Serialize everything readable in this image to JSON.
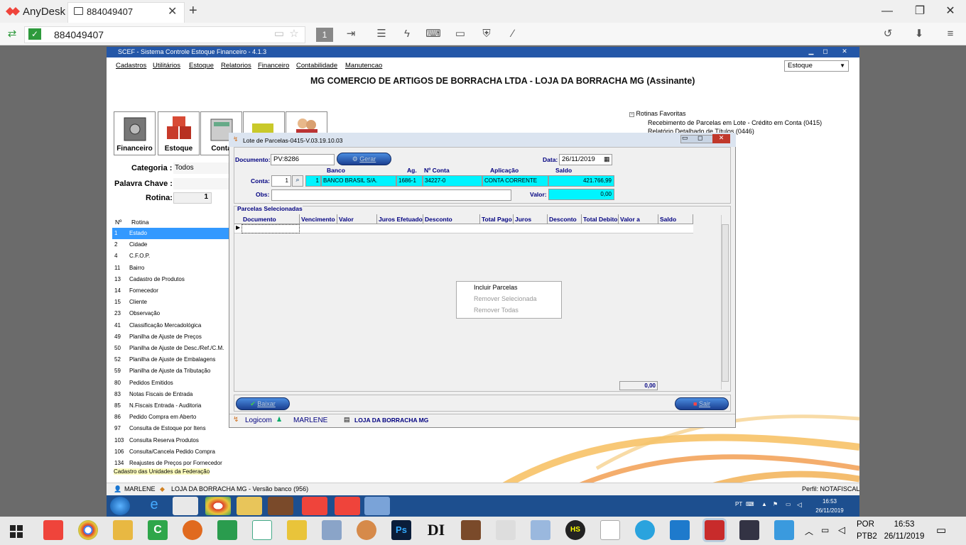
{
  "anydesk": {
    "brand": "AnyDesk",
    "tab_label": "884049407",
    "address": "884049407",
    "toolbar_page": "1",
    "colors": {
      "accent": "#ef443b"
    }
  },
  "scef": {
    "window_title": "SCEF - Sistema Controle Estoque Financeiro - 4.1.3",
    "menu": [
      "Cadastros",
      "Utilitários",
      "Estoque",
      "Relatorios",
      "Financeiro",
      "Contabilidade",
      "Manutencao"
    ],
    "module_select": "Estoque",
    "company_title": "MG COMERCIO DE ARTIGOS DE BORRACHA LTDA - LOJA DA BORRACHA MG (Assinante)",
    "modules": [
      "Financeiro",
      "Estoque",
      "Conta"
    ],
    "categoria_label": "Categoria :",
    "categoria_value": "Todos",
    "palavra_chave_label": "Palavra Chave :",
    "rotina_label": "Rotina:",
    "rotina_value": "1",
    "rotinas_header": {
      "num": "Nº",
      "name": "Rotina"
    },
    "rotinas": [
      {
        "num": "1",
        "name": "Estado"
      },
      {
        "num": "2",
        "name": "Cidade"
      },
      {
        "num": "4",
        "name": "C.F.O.P."
      },
      {
        "num": "11",
        "name": "Bairro"
      },
      {
        "num": "13",
        "name": "Cadastro de Produtos"
      },
      {
        "num": "14",
        "name": "Fornecedor"
      },
      {
        "num": "15",
        "name": "Cliente"
      },
      {
        "num": "23",
        "name": "Observação"
      },
      {
        "num": "41",
        "name": "Classificação Mercadológica"
      },
      {
        "num": "49",
        "name": "Planilha de Ajuste de Preços"
      },
      {
        "num": "50",
        "name": "Planilha de Ajuste de Desc./Ref./C.M."
      },
      {
        "num": "52",
        "name": "Planilha de Ajuste de Embalagens"
      },
      {
        "num": "59",
        "name": "Planilha de Ajuste da Tributação"
      },
      {
        "num": "80",
        "name": "Pedidos Emitidos"
      },
      {
        "num": "83",
        "name": "Notas Fiscais de Entrada"
      },
      {
        "num": "85",
        "name": "N.Fiscais Entrada - Auditoria"
      },
      {
        "num": "86",
        "name": "Pedido Compra em Aberto"
      },
      {
        "num": "97",
        "name": "Consulta de Estoque por Itens"
      },
      {
        "num": "103",
        "name": "Consulta Reserva Produtos"
      },
      {
        "num": "106",
        "name": "Consulta/Cancela Pedido Compra"
      },
      {
        "num": "134",
        "name": "Reajustes de Preços por Fornecedor"
      }
    ],
    "rotina_hint": "Cadastro das Unidades da Federação",
    "favorites_title": "Rotinas Favoritas",
    "favorites": [
      "Recebimento de Parcelas em Lote - Crédito em Conta (0415)",
      "Relatório Detalhado de Títulos (0446)"
    ],
    "status_user": "MARLENE",
    "status_store": "LOJA DA BORRACHA MG - Versão banco (956)",
    "status_profile": "Perfil: NOTAFISCAL"
  },
  "dialog": {
    "title": "Lote de Parcelas-0415-V.03.19.10.03",
    "documento_label": "Documento:",
    "documento_value": "PV:8286",
    "gerar_label": "Gerar",
    "data_label": "Data:",
    "data_value": "26/11/2019",
    "conta_label": "Conta:",
    "conta_value": "1",
    "headers": {
      "banco": "Banco",
      "ag": "Ag.",
      "nconta": "Nº Conta",
      "aplicacao": "Aplicação",
      "saldo": "Saldo"
    },
    "banco_num": "1",
    "banco_name": "BANCO BRASIL S/A.",
    "agencia": "1686-1",
    "numero_conta": "34227-0",
    "aplicacao": "CONTA CORRENTE",
    "saldo": "421.766,99",
    "obs_label": "Obs:",
    "valor_label": "Valor:",
    "valor_value": "0,00",
    "parcelas_title": "Parcelas Selecionadas",
    "columns": [
      "Documento",
      "Vencimento",
      "Valor Parcela",
      "Juros Efetuado",
      "Desconto Efetuado",
      "Total Pago",
      "Juros",
      "Desconto",
      "Total Debito",
      "Valor a Pagar",
      "Saldo"
    ],
    "total": "0,00",
    "context_menu": [
      "Incluir Parcelas",
      "Remover Selecionada",
      "Remover Todas"
    ],
    "baixar_label": "Baixar",
    "sair_label": "Sair",
    "footer_company": "Logicom",
    "footer_user": "MARLENE",
    "footer_store": "LOJA DA BORRACHA MG"
  },
  "remote_tray": {
    "lang": "PT",
    "time": "16:53",
    "date": "26/11/2019"
  },
  "windows_tray": {
    "lang1": "POR",
    "lang2": "PTB2",
    "time": "16:53",
    "date": "26/11/2019"
  }
}
